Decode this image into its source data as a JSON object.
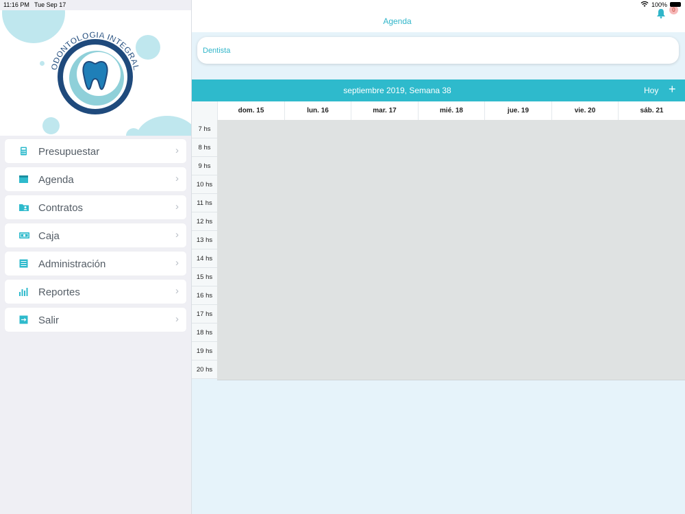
{
  "status_bar": {
    "time": "11:16 PM",
    "date": "Tue Sep 17",
    "battery": "100%"
  },
  "logo": {
    "text": "ODONTOLOGIA INTEGRAL"
  },
  "menu": [
    {
      "label": "Presupuestar",
      "icon": "calculator-icon"
    },
    {
      "label": "Agenda",
      "icon": "calendar-icon"
    },
    {
      "label": "Contratos",
      "icon": "contact-folder-icon"
    },
    {
      "label": "Caja",
      "icon": "cash-icon"
    },
    {
      "label": "Administración",
      "icon": "list-icon"
    },
    {
      "label": "Reportes",
      "icon": "bar-chart-icon"
    },
    {
      "label": "Salir",
      "icon": "logout-icon"
    }
  ],
  "header": {
    "title": "Agenda",
    "notifications": "0"
  },
  "dentist_field": {
    "value": "Dentista"
  },
  "calendar": {
    "week_label": "septiembre 2019, Semana 38",
    "today_label": "Hoy",
    "add_label": "+",
    "days": [
      "dom. 15",
      "lun. 16",
      "mar. 17",
      "mié. 18",
      "jue. 19",
      "vie. 20",
      "sáb. 21"
    ],
    "hours": [
      "7 hs",
      "8 hs",
      "9 hs",
      "10 hs",
      "11 hs",
      "12 hs",
      "13 hs",
      "14 hs",
      "15 hs",
      "16 hs",
      "17 hs",
      "18 hs",
      "19 hs",
      "20 hs"
    ]
  },
  "colors": {
    "accent": "#2ebacc",
    "sidebar_bg": "#efeff4",
    "main_bg": "#e6f3fa",
    "grid": "#dfe2e2"
  }
}
